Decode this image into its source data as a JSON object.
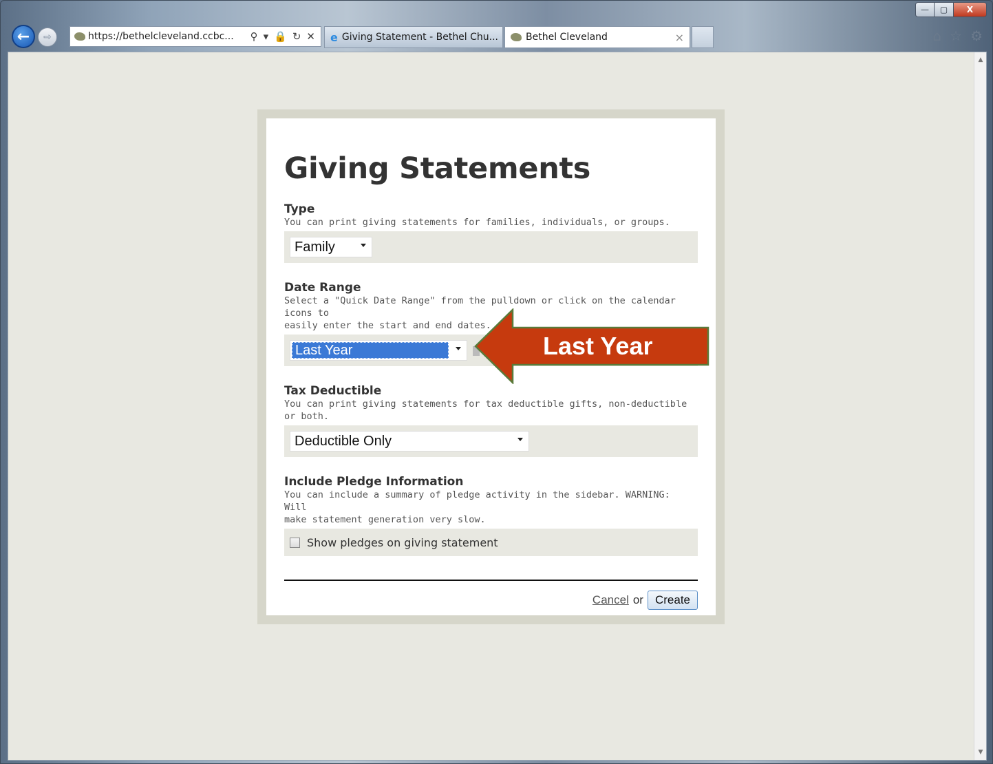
{
  "browser": {
    "url": "https://bethelcleveland.ccbc...",
    "tabs": [
      {
        "label": "Giving Statement - Bethel Chu...",
        "active": false
      },
      {
        "label": "Bethel Cleveland",
        "active": true
      }
    ],
    "window_controls": {
      "minimize": "—",
      "maximize": "▢",
      "close": "X"
    }
  },
  "page": {
    "title": "Giving Statements",
    "type": {
      "label": "Type",
      "help": "You can print giving statements for families, individuals, or groups.",
      "value": "Family"
    },
    "date_range": {
      "label": "Date Range",
      "help_line1": "Select a \"Quick Date Range\" from the pulldown or click on the calendar icons to",
      "help_line2": "easily enter the start and end dates.",
      "value": "Last Year"
    },
    "tax_deductible": {
      "label": "Tax Deductible",
      "help": "You can print giving statements for tax deductible gifts, non-deductible or both.",
      "value": "Deductible Only"
    },
    "pledge": {
      "label": "Include Pledge Information",
      "help_line1": "You can include a summary of pledge activity in the sidebar. WARNING: Will",
      "help_line2": "make statement generation very slow.",
      "checkbox_label": "Show pledges on giving statement",
      "checked": false
    },
    "actions": {
      "cancel": "Cancel",
      "or": "or",
      "create": "Create"
    }
  },
  "callout": {
    "text": "Last Year",
    "color": "#c63a0e",
    "border": "#5a7a3a"
  }
}
